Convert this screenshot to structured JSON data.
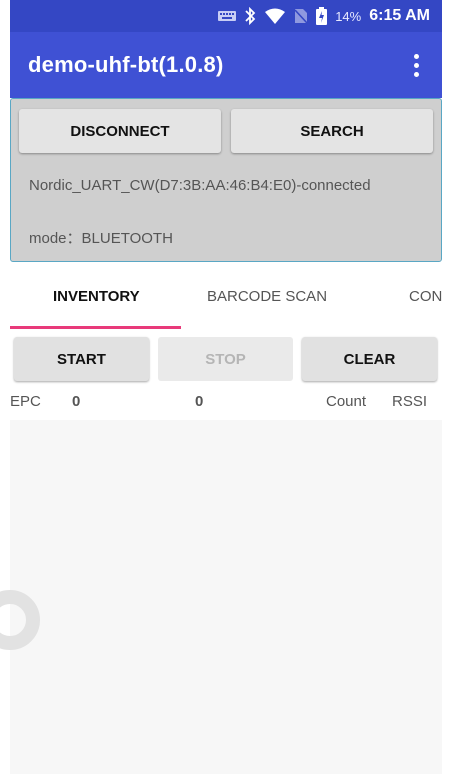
{
  "status_bar": {
    "icons": [
      "keyboard-icon",
      "bluetooth-icon",
      "wifi-icon",
      "no-sim-icon",
      "battery-charging-icon"
    ],
    "battery_percent": "14%",
    "time": "6:15 AM"
  },
  "app_bar": {
    "title": "demo-uhf-bt(1.0.8)",
    "overflow_icon": "more-vert-icon"
  },
  "connection": {
    "disconnect_label": "DISCONNECT",
    "search_label": "SEARCH",
    "status_text": "Nordic_UART_CW(D7:3B:AA:46:B4:E0)-connected",
    "mode_text": "mode：BLUETOOTH"
  },
  "tabs": [
    {
      "label": "INVENTORY",
      "selected": true
    },
    {
      "label": "BARCODE SCAN",
      "selected": false
    },
    {
      "label": "CON",
      "selected": false
    }
  ],
  "actions": {
    "start_label": "START",
    "stop_label": "STOP",
    "clear_label": "CLEAR"
  },
  "inventory": {
    "epc_label": "EPC",
    "tag_count": "0",
    "total_count": "0",
    "count_label": "Count",
    "rssi_label": "RSSI"
  },
  "colors": {
    "status_bar": "#3447c4",
    "app_bar": "#3f51d4",
    "tab_indicator": "#e83a7a",
    "panel_border": "#5aa7c4"
  }
}
